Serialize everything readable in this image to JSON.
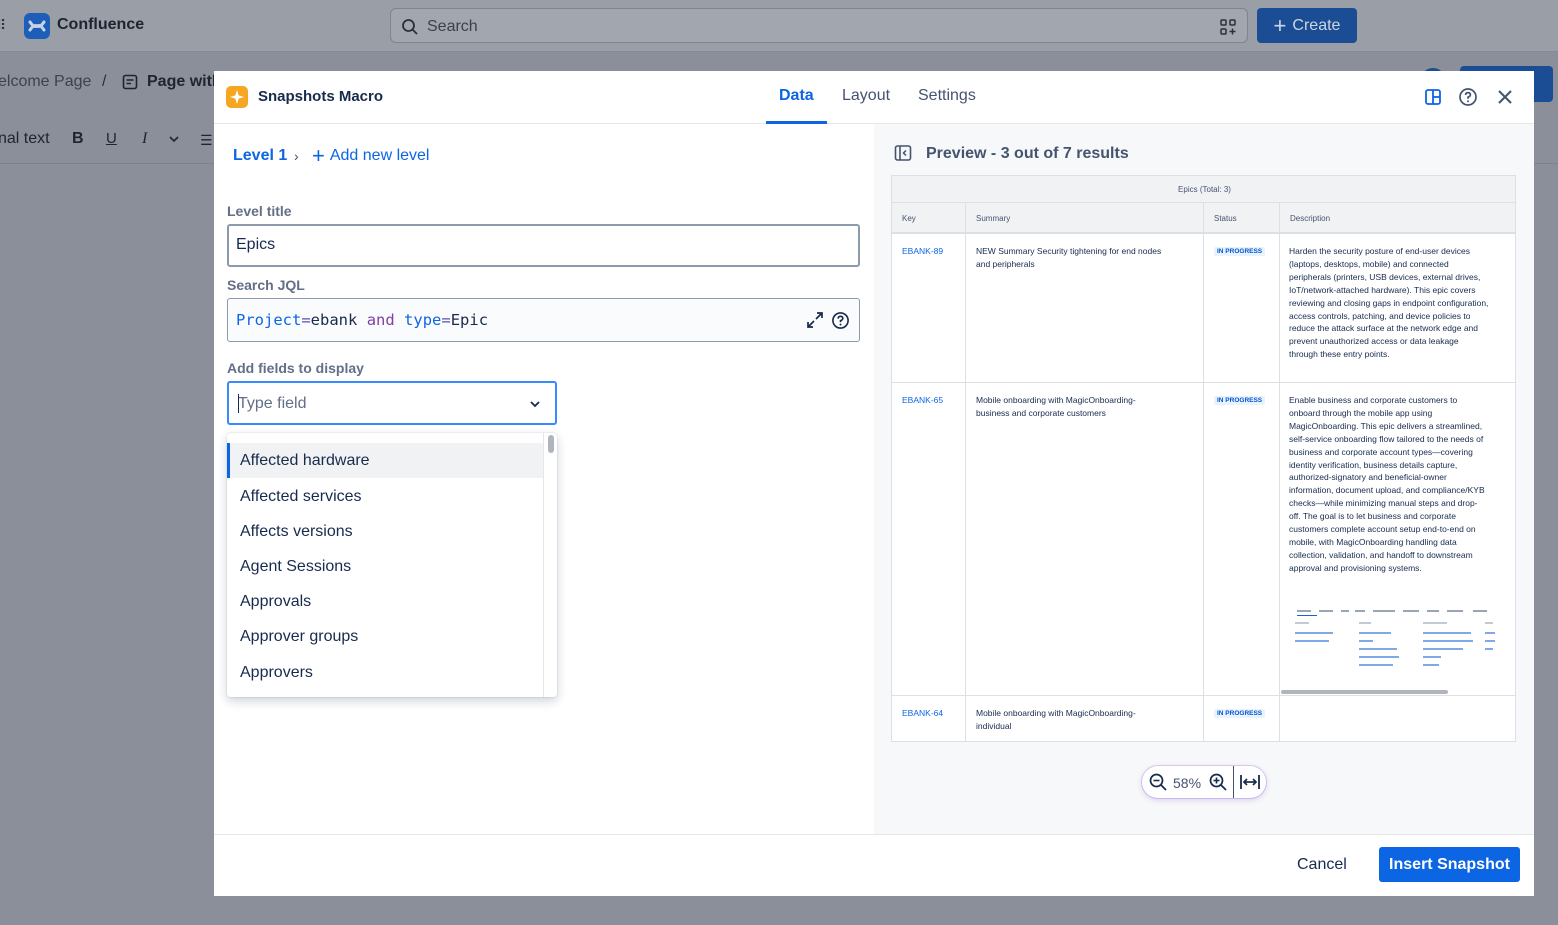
{
  "app": {
    "name": "Confluence",
    "search_placeholder": "Search",
    "create_label": "Create",
    "breadcrumb_first": "elcome Page",
    "breadcrumb_sep": "/",
    "breadcrumb_page": "Page with",
    "toolbar_text_style": "nal text"
  },
  "modal": {
    "title": "Snapshots Macro",
    "tabs": [
      {
        "label": "Data",
        "active": true
      },
      {
        "label": "Layout",
        "active": false
      },
      {
        "label": "Settings",
        "active": false
      }
    ],
    "header_icons": [
      "layout-icon",
      "help-icon",
      "close-icon"
    ],
    "levels": {
      "current": "Level 1",
      "add_label": "Add new level"
    },
    "level_title": {
      "label": "Level title",
      "value": "Epics"
    },
    "search_jql": {
      "label": "Search JQL",
      "tokens": [
        "Project",
        "=",
        "ebank",
        "and",
        "type",
        "=",
        "Epic"
      ]
    },
    "fields": {
      "label": "Add fields to display",
      "placeholder": "Type field",
      "options": [
        "Affected hardware",
        "Affected services",
        "Affects versions",
        "Agent Sessions",
        "Approvals",
        "Approver groups",
        "Approvers"
      ]
    },
    "preview": {
      "title": "Preview - 3 out of 7 results",
      "table_title": "Epics (Total: 3)",
      "columns": [
        "Key",
        "Summary",
        "Status",
        "Description"
      ],
      "rows": [
        {
          "key": "EBANK-89",
          "summary": "NEW Summary Security tightening for end nodes and peripherals",
          "status": "IN PROGRESS",
          "description": "Harden the security posture of end-user devices (laptops, desktops, mobile) and connected peripherals (printers, USB devices, external drives, IoT/network-attached hardware). This epic covers reviewing and closing gaps in endpoint configuration, access controls, patching, and device policies to reduce the attack surface at the network edge and prevent unauthorized access or data leakage through these entry points."
        },
        {
          "key": "EBANK-65",
          "summary": "Mobile onboarding with MagicOnboarding-business and corporate customers",
          "status": "IN PROGRESS",
          "description": "Enable business and corporate customers to onboard through the mobile app using MagicOnboarding. This epic delivers a streamlined, self-service onboarding flow tailored to the needs of business and corporate account types—covering identity verification, business details capture, authorized-signatory and beneficial-owner information, document upload, and compliance/KYB checks—while minimizing manual steps and drop-off. The goal is to let business and corporate customers complete account setup end-to-end on mobile, with MagicOnboarding handling data collection, validation, and handoff to downstream approval and provisioning systems."
        },
        {
          "key": "EBANK-64",
          "summary": "Mobile onboarding with MagicOnboarding-individual",
          "status": "IN PROGRESS",
          "description": ""
        }
      ],
      "zoom": "58%"
    },
    "footer": {
      "cancel_label": "Cancel",
      "insert_label": "Insert Snapshot"
    }
  }
}
